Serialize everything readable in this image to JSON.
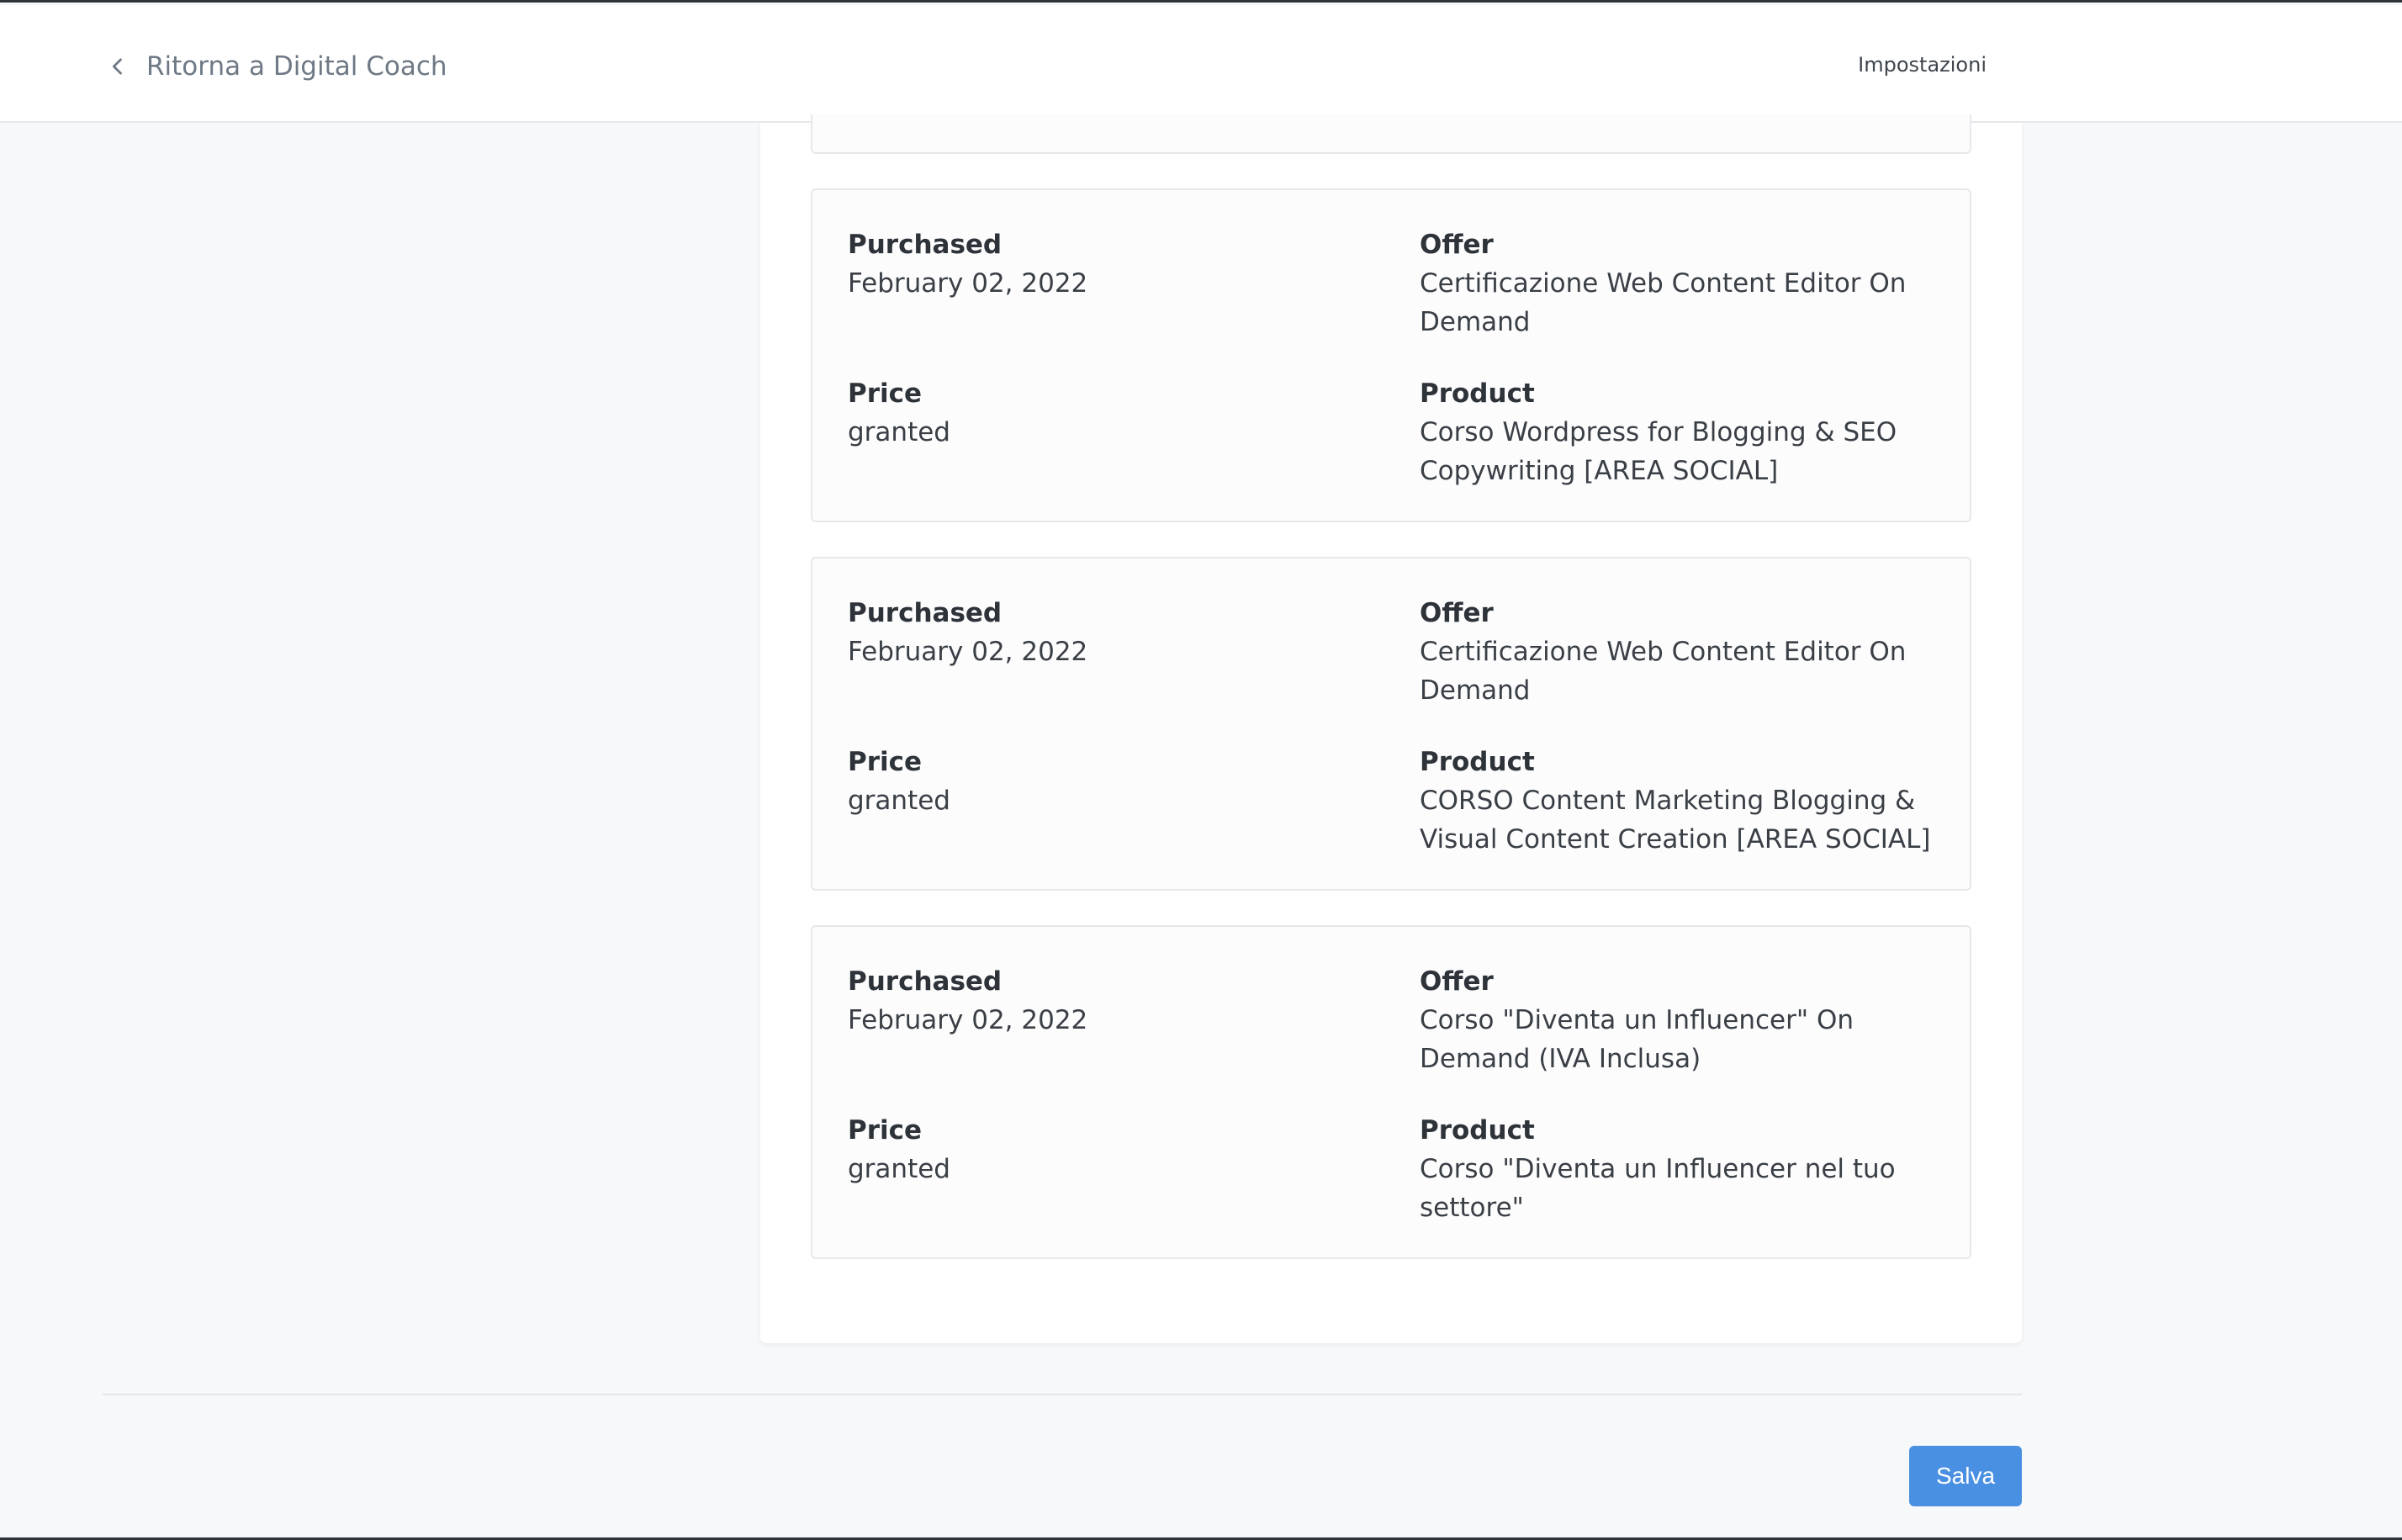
{
  "header": {
    "back_label": "Ritorna a Digital Coach",
    "settings_label": "Impostazioni"
  },
  "purchases": [
    {
      "purchased_label": "Purchased",
      "purchased": "February 02, 2022",
      "offer_label": "Offer",
      "offer": "Certificazione Web Content Editor On Demand",
      "price_label": "Price",
      "price": "granted",
      "product_label": "Product",
      "product": "Corso Wordpress for Blogging & SEO Copywriting [AREA SOCIAL]"
    },
    {
      "purchased_label": "Purchased",
      "purchased": "February 02, 2022",
      "offer_label": "Offer",
      "offer": "Certificazione Web Content Editor On Demand",
      "price_label": "Price",
      "price": "granted",
      "product_label": "Product",
      "product": "CORSO Content Marketing Blogging & Visual Content Creation [AREA SOCIAL]"
    },
    {
      "purchased_label": "Purchased",
      "purchased": "February 02, 2022",
      "offer_label": "Offer",
      "offer": "Corso \"Diventa un Influencer\" On Demand (IVA Inclusa)",
      "price_label": "Price",
      "price": "granted",
      "product_label": "Product",
      "product": "Corso \"Diventa un Influencer nel tuo settore\""
    }
  ],
  "footer": {
    "save_label": "Salva"
  },
  "icons": {
    "back": "chevron-left-icon"
  },
  "colors": {
    "accent": "#4a90e2",
    "background": "#f7f8fa"
  }
}
